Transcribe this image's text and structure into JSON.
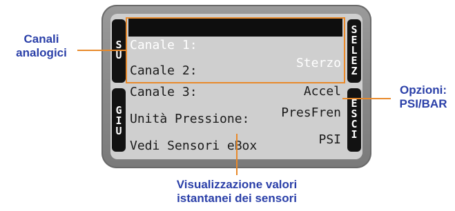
{
  "callouts": {
    "analog": [
      "Canali",
      "analogici"
    ],
    "options": [
      "Opzioni:",
      "PSI/BAR"
    ],
    "values": [
      "Visualizzazione valori",
      "istantanei dei sensori"
    ]
  },
  "display": {
    "rows": [
      {
        "label": "Canale 1:",
        "value": "Sterzo",
        "selected": true
      },
      {
        "label": "Canale 2:",
        "value": "Accel",
        "selected": false
      },
      {
        "label": "Canale 3:",
        "value": "PresFren",
        "selected": false
      },
      {
        "label": "Unità Pressione:",
        "value": "PSI",
        "selected": false
      },
      {
        "label": "Vedi Sensori eBox",
        "value": "",
        "selected": false
      }
    ]
  },
  "buttons": {
    "up": "SU",
    "down": "GIU",
    "select": "SELEZ",
    "exit": "ESCI"
  },
  "colors": {
    "accent": "#e8892a",
    "callout_text": "#2a3fa8",
    "screen": "#cfcfcf",
    "bezel": "#8a8a8a"
  }
}
